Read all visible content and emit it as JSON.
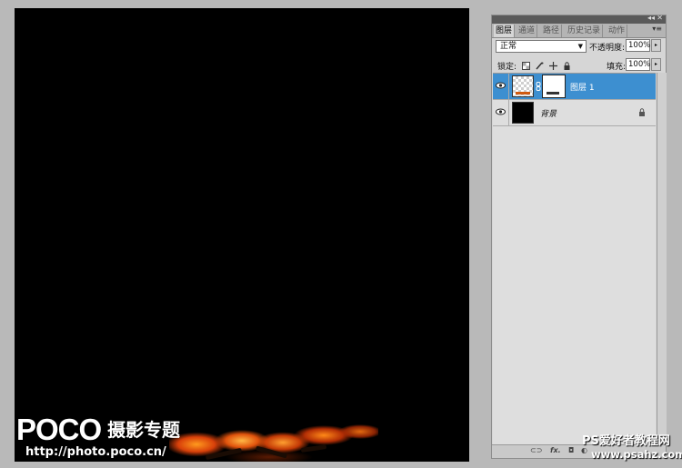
{
  "canvas": {
    "watermark": {
      "logo": "POCO",
      "title": "摄影专题",
      "url": "http://photo.poco.cn/"
    }
  },
  "layers_panel": {
    "tabs": [
      {
        "label": "图层",
        "active": true
      },
      {
        "label": "通道",
        "active": false
      },
      {
        "label": "路径",
        "active": false
      },
      {
        "label": "历史记录",
        "active": false
      },
      {
        "label": "动作",
        "active": false
      }
    ],
    "blend_mode": "正常",
    "opacity_label": "不透明度:",
    "opacity_value": "100%",
    "lock_label": "锁定:",
    "fill_label": "填充:",
    "fill_value": "100%",
    "layers": [
      {
        "name": "图层 1",
        "visible": true,
        "selected": true,
        "has_mask": true,
        "thumbnail": "transparent-checker"
      },
      {
        "name": "背景",
        "visible": true,
        "selected": false,
        "locked": true,
        "thumbnail": "black"
      }
    ],
    "bottom_icons": [
      "link-icon",
      "fx-icon",
      "mask-icon",
      "adjustment-icon",
      "folder-icon",
      "new-layer-icon",
      "trash-icon"
    ]
  },
  "site_watermark": {
    "line1": "PS爱好者教程网",
    "line2": "www.psahz.com"
  },
  "colors": {
    "selection": "#3d8fd0",
    "panel_bg": "#d6d6d6",
    "workspace_bg": "#b9b9b9",
    "canvas_bg": "#000000"
  }
}
